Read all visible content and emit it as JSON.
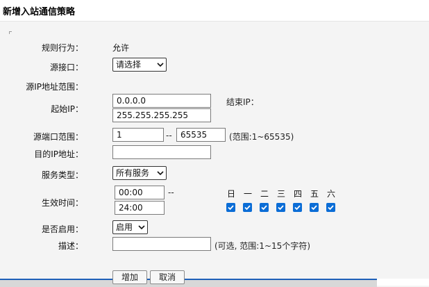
{
  "title": "新增入站通信策略",
  "rows": {
    "action_label": "规则行为：",
    "action_value": "允许",
    "src_iface_label": "源接口：",
    "src_iface_value": "请选择",
    "src_ip_range_label": "源IP地址范围：",
    "start_ip_label": "起始IP：",
    "start_ip_value": "0.0.0.0",
    "end_ip_label": "结束IP：",
    "end_ip_value": "255.255.255.255",
    "src_port_label": "源端口范围：",
    "src_port_start": "1",
    "src_port_sep": "--",
    "src_port_end": "65535",
    "src_port_hint": "(范围:1~65535)",
    "dst_ip_label": "目的IP地址：",
    "dst_ip_value": "",
    "service_label": "服务类型：",
    "service_value": "所有服务",
    "time_label": "生效时间：",
    "time_start": "00:00",
    "time_sep": "--",
    "time_end": "24:00",
    "enable_label": "是否启用：",
    "enable_value": "启用",
    "desc_label": "描述：",
    "desc_value": "",
    "desc_hint": "(可选, 范围:1~15个字符)"
  },
  "days": [
    {
      "label": "日",
      "checked": true
    },
    {
      "label": "一",
      "checked": true
    },
    {
      "label": "二",
      "checked": true
    },
    {
      "label": "三",
      "checked": true
    },
    {
      "label": "四",
      "checked": true
    },
    {
      "label": "五",
      "checked": true
    },
    {
      "label": "六",
      "checked": true
    }
  ],
  "buttons": {
    "add": "增加",
    "cancel": "取消"
  },
  "colors": {
    "checkbox": "#0b6dd6",
    "accent_line": "#1e60b8"
  }
}
